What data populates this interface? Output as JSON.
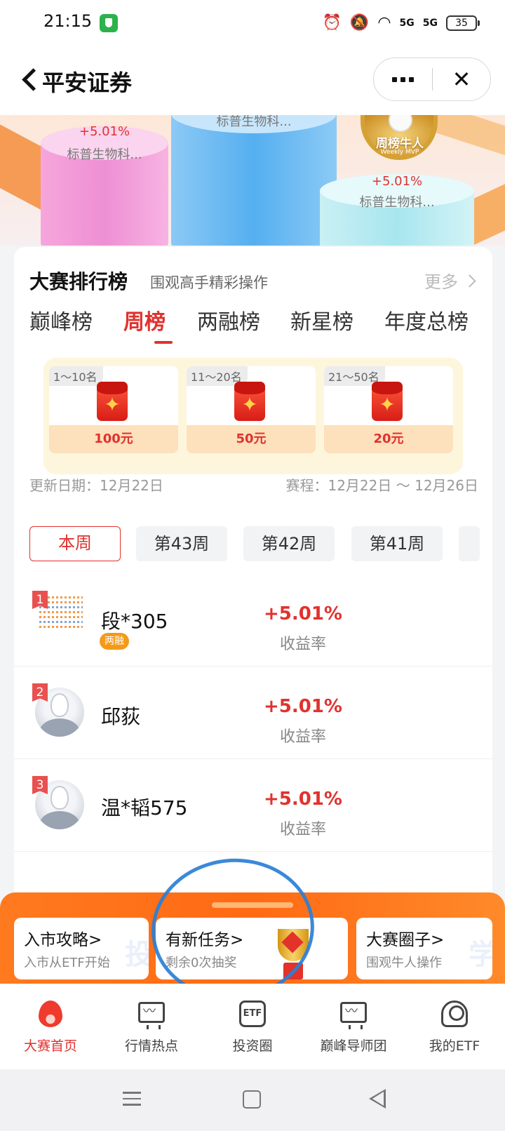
{
  "status_bar": {
    "time": "21:15",
    "signal1": "5G",
    "signal2": "5G",
    "battery": "35",
    "icons": [
      "alarm-icon",
      "mute-icon",
      "wifi-icon",
      "signal-icon",
      "battery-icon"
    ]
  },
  "nav": {
    "title": "平安证券",
    "more_icon": "more-dots-icon",
    "close_icon": "close-icon"
  },
  "banner": {
    "left": {
      "pct": "+5.01%",
      "name": "标普生物科..."
    },
    "center": {
      "name": "标普生物科..."
    },
    "right": {
      "pct": "+5.01%",
      "name": "标普生物科...",
      "medal": "周榜牛人",
      "medal_sub": "Weekly MVP"
    }
  },
  "leaderboard": {
    "title": "大赛排行榜",
    "subtitle": "围观高手精彩操作",
    "more": "更多",
    "tabs": [
      "巅峰榜",
      "周榜",
      "两融榜",
      "新星榜",
      "年度总榜"
    ],
    "active_tab": 1,
    "rewards": [
      {
        "range": "1～10名",
        "value": "100元"
      },
      {
        "range": "11～20名",
        "value": "50元"
      },
      {
        "range": "21～50名",
        "value": "20元"
      }
    ],
    "update_date": "更新日期：12月22日",
    "schedule": "赛程：12月22日 ～ 12月26日",
    "weeks": [
      "本周",
      "第43周",
      "第42周",
      "第41周"
    ],
    "active_week": 0,
    "entries": [
      {
        "rank": "1",
        "name": "段*305",
        "tag": "两融",
        "return": "+5.01%",
        "return_label": "收益率"
      },
      {
        "rank": "2",
        "name": "邱荻",
        "return": "+5.01%",
        "return_label": "收益率"
      },
      {
        "rank": "3",
        "name": "温*韬575",
        "return": "+5.01%",
        "return_label": "收益率"
      }
    ]
  },
  "drawer": {
    "cards": [
      {
        "title": "入市攻略>",
        "subtitle": "入市从ETF开始"
      },
      {
        "title": "有新任务>",
        "subtitle": "剩余0次抽奖"
      },
      {
        "title": "大赛圈子>",
        "subtitle": "围观牛人操作"
      }
    ]
  },
  "tabbar": {
    "items": [
      {
        "label": "大赛首页",
        "icon": "flame-icon"
      },
      {
        "label": "行情热点",
        "icon": "monitor-chart-icon"
      },
      {
        "label": "投资圈",
        "icon": "etf-hexagon-icon",
        "icon_text": "ETF"
      },
      {
        "label": "巅峰导师团",
        "icon": "chart-board-icon"
      },
      {
        "label": "我的ETF",
        "icon": "user-icon"
      }
    ],
    "active": 0
  },
  "colors": {
    "accent": "#e0322e",
    "drawer": "#ff6a14",
    "annotation": "#2a7fd6"
  }
}
